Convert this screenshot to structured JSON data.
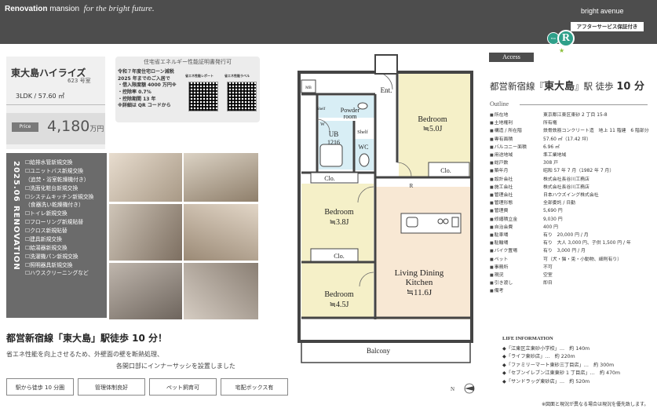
{
  "header": {
    "brand_bold": "Renovation",
    "brand_rest": " mansion",
    "tagline": "for the bright future.",
    "eco_badge": "ECO CUBE",
    "eco_letter": "R",
    "bright": "bright avenue",
    "after_service": "アフターサービス保証付き"
  },
  "property": {
    "name": "東大島ハイライズ",
    "room": "623 号室",
    "layout": "3LDK / 57.60 ㎡",
    "price_label": "Price",
    "price": "4,180",
    "price_unit": "万円"
  },
  "eco_cert": {
    "title": "住宅省エネルギー性能証明書発行可",
    "lines": [
      "令和７年度住宅ローン減税",
      "2025 年までのご入居で",
      "・借入限度額 4000 万円※",
      "・控除率 0.7%",
      "・控除期間 13 年",
      "※詳細は QR コードから"
    ],
    "qr1_label": "省エネ性能レポート",
    "qr2_label": "省エネ性能ラベル"
  },
  "renovation": {
    "date": "2025.06 RENOVATION",
    "items": [
      "☐給排水管新規交換",
      "☐ユニットバス新規交換",
      "（追焚・浴室乾燥機付き）",
      "☐洗面化粧台新規交換",
      "☐システムキッチン新規交換",
      "（食器洗い乾燥機付き）",
      "☐トイレ新規交換",
      "☐フローリング新規貼替",
      "☐クロス新規貼替",
      "☐建具新規交換",
      "☐給湯器新規交換",
      "☐洗濯機パン新規交換",
      "☐照明器具新規交換",
      "☐ハウスクリーニングなど"
    ]
  },
  "promo": {
    "headline": "都営新宿線「東大島」駅徒歩 10 分！",
    "desc1": "省エネ性能を向上させるため、外壁面の壁を断熱処理、",
    "desc2": "各開口部にインナーサッシを設置しました",
    "tags": [
      "駅から徒歩 10 分圏",
      "管理体制良好",
      "ペット飼育可",
      "宅配ボックス有"
    ]
  },
  "floorplan": {
    "mb": "MB",
    "ent": "Ent.",
    "bedroom1": "Bedroom",
    "bedroom1_size": "≒5.0J",
    "powder": "Powder",
    "powder2": "room",
    "shelf1": "Shelf",
    "shelf2": "Shelf",
    "ub": "UB",
    "ub_size": "1216",
    "w": "W",
    "wc": "WC",
    "clo1": "Clo.",
    "clo2": "Clo.",
    "clo3": "Clo.",
    "r": "R",
    "bedroom2": "Bedroom",
    "bedroom2_size": "≒3.8J",
    "ldk": "Living Dining",
    "ldk2": "Kitchen",
    "ldk_size": "≒11.6J",
    "bedroom3": "Bedroom",
    "bedroom3_size": "≒4.5J",
    "balcony": "Balcony",
    "north": "N"
  },
  "access": {
    "label": "Access",
    "station_pre": "都営新宿線『",
    "station_name": "東大島",
    "station_post": "』駅 徒歩",
    "minutes": "10 分",
    "outline": "Outline"
  },
  "spec": [
    [
      "所在地",
      "東京都江東区東砂 2 丁目 15-8"
    ],
    [
      "土地権利",
      "所有権"
    ],
    [
      "構造 / 所在階",
      "鉄骨鉄筋コンクリート造　地上 11 階建　6 階部分"
    ],
    [
      "専有面積",
      "57.60 ㎡（17.42 坪）"
    ],
    [
      "バルコニー面積",
      "6.96 ㎡"
    ],
    [
      "用途地域",
      "準工業地域"
    ],
    [
      "総戸数",
      "308 戸"
    ],
    [
      "築年月",
      "昭和 57 年 7 月（1982 年 7 月）"
    ],
    [
      "設計会社",
      "株式会社長谷川工務店"
    ],
    [
      "施工会社",
      "株式会社長谷川工務店"
    ],
    [
      "管理会社",
      "日本ハウズイング株式会社"
    ],
    [
      "管理形態",
      "全部委託 / 日勤"
    ],
    [
      "管理費",
      "5,690 円"
    ],
    [
      "修繕積立金",
      "9,030 円"
    ],
    [
      "自治会費",
      "400 円"
    ],
    [
      "駐車場",
      "有り　20,000 円 / 月"
    ],
    [
      "駐輪場",
      "有り　大人 3,000 円、子供 1,500 円 / 年"
    ],
    [
      "バイク置場",
      "有り　3,000 円 / 月"
    ],
    [
      "ペット",
      "可（犬・猫・兎・小動物、細則有り）"
    ],
    [
      "事務所",
      "不可"
    ],
    [
      "現況",
      "空室"
    ],
    [
      "引き渡し",
      "即日"
    ],
    [
      "備考",
      ""
    ]
  ],
  "life": {
    "title": "LIFE INFORMATION",
    "items": [
      "◆「江東区立東砂小学校」…　約 140m",
      "◆「ライフ東砂店」…　約 220m",
      "◆「ファミリーマート東砂三丁目店」…　約 300m",
      "◆「セブンイレブン江東東砂 1 丁目店」…　約 470m",
      "◆「サンドラッグ東砂店」…　約 520m"
    ],
    "note": "※図面と現況が異なる場合は現況を優先致します。"
  },
  "colors": {
    "header": "#4d4d4d",
    "eco": "#2fa08a",
    "bedroom": "#f5f0c8",
    "ldk": "#f8e8d4",
    "wet": "#d8eef5"
  }
}
